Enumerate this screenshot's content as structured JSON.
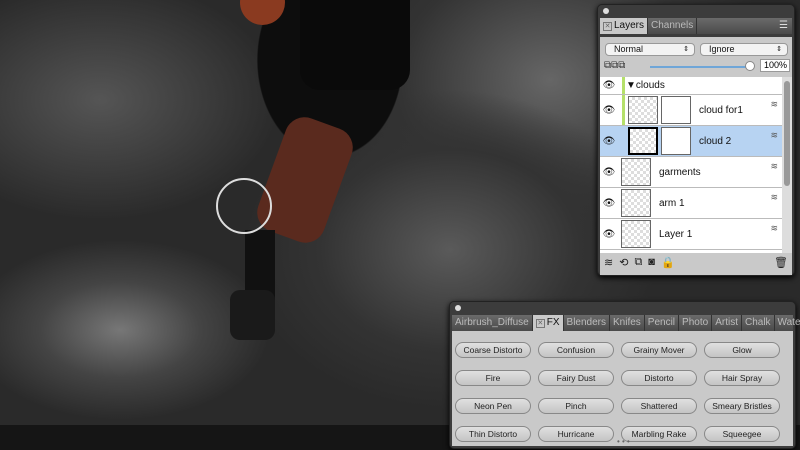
{
  "layers_panel": {
    "tabs": [
      "Layers",
      "Channels"
    ],
    "blend_mode": "Normal",
    "composite": "Ignore",
    "opacity": "100%",
    "group": "clouds",
    "layers": [
      {
        "name": "cloud for1",
        "selected": false
      },
      {
        "name": "cloud 2",
        "selected": true
      },
      {
        "name": "garments",
        "selected": false
      },
      {
        "name": "arm 1",
        "selected": false
      },
      {
        "name": "Layer 1",
        "selected": false
      }
    ]
  },
  "brush_panel": {
    "tabs": [
      "Airbrush_Diffuse",
      "FX",
      "Blenders",
      "Knifes",
      "Pencil",
      "Photo",
      "Artist",
      "Chalk",
      "Watercolour"
    ],
    "active_tab": "FX",
    "brushes": [
      "Coarse Distorto",
      "Confusion",
      "Grainy Mover",
      "Glow",
      "Fire",
      "Fairy Dust",
      "Distorto",
      "Hair Spray",
      "Neon Pen",
      "Pinch",
      "Shattered",
      "Smeary Bristles",
      "Thin Distorto",
      "Hurricane",
      "Marbling Rake",
      "Squeegee"
    ]
  }
}
